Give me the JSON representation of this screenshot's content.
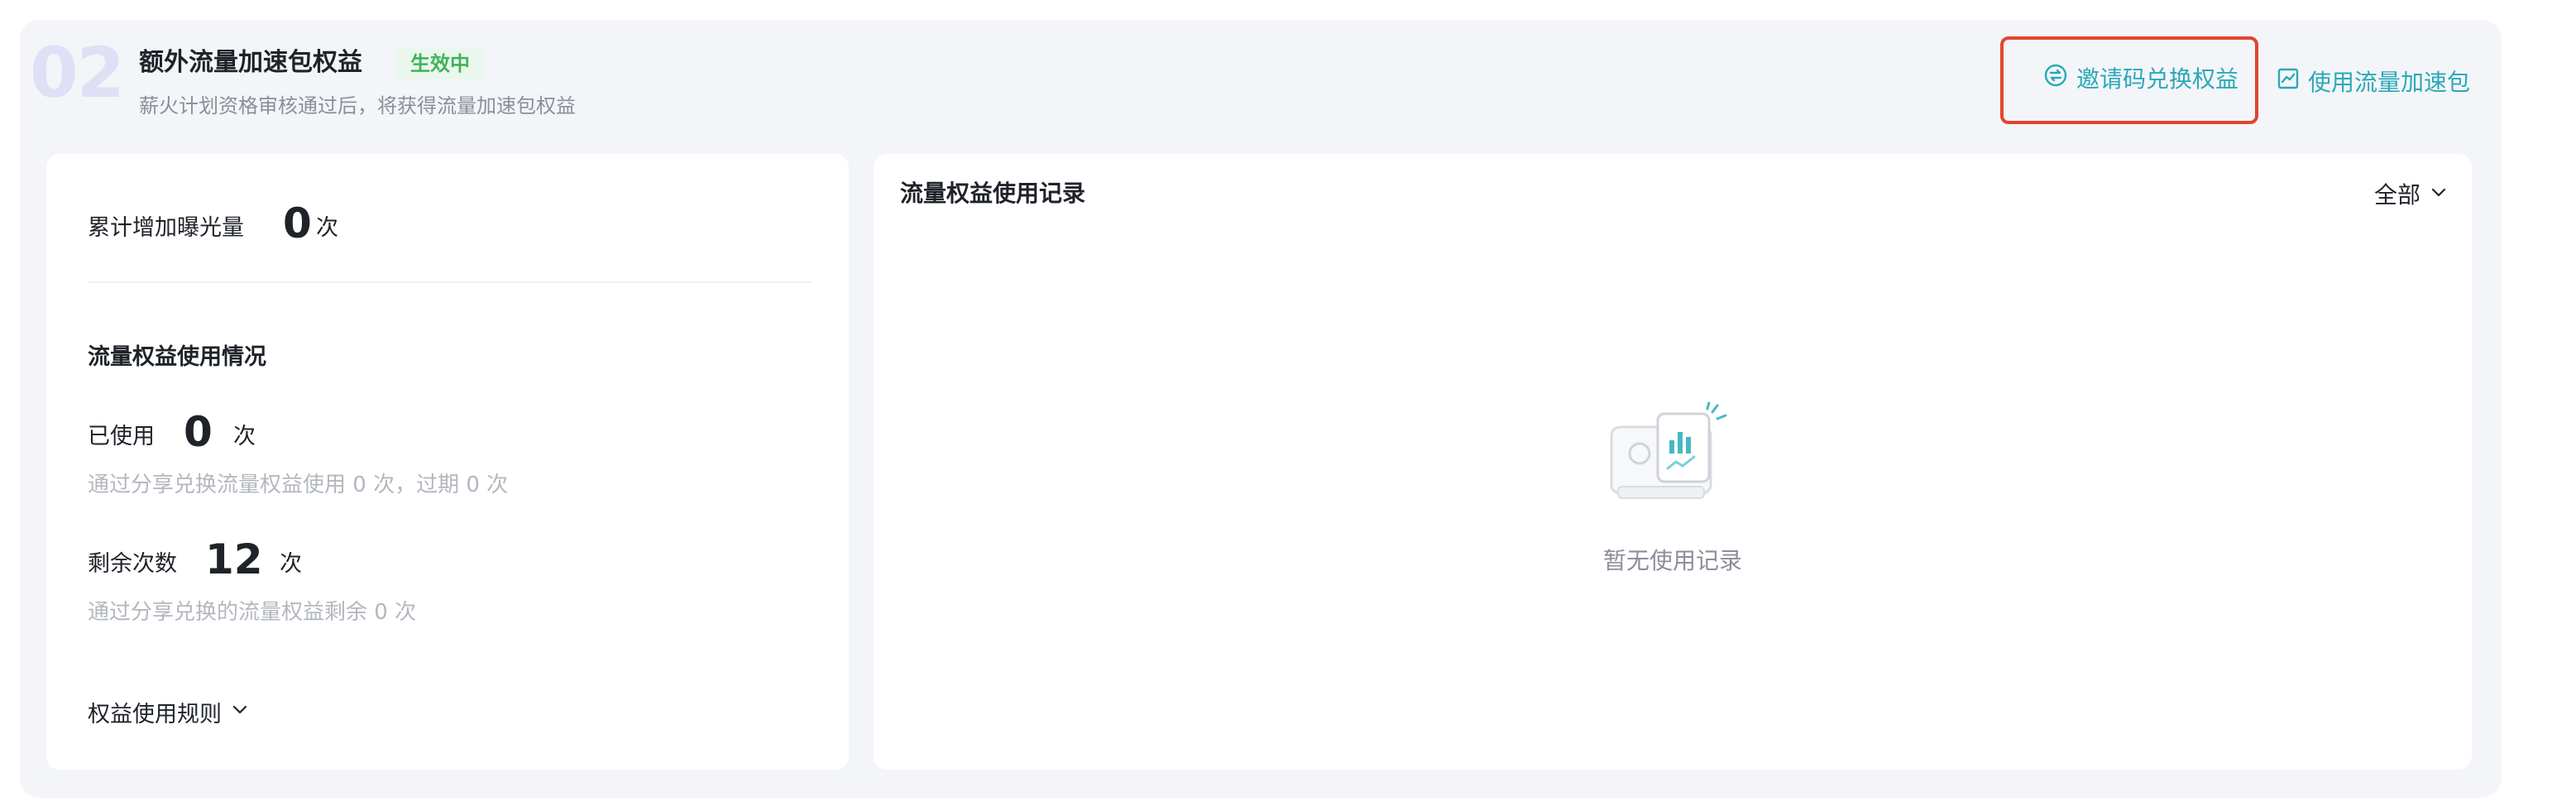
{
  "section": {
    "number": "02",
    "title": "额外流量加速包权益",
    "status": "生效中",
    "subtitle": "薪火计划资格审核通过后，将获得流量加速包权益"
  },
  "actions": {
    "invite_label": "邀请码兑换权益",
    "invite_icon": "exchange-icon",
    "boost_label": "使用流量加速包",
    "boost_icon": "trend-chart-icon",
    "accent_color": "#2aa9b8",
    "highlight_color": "#e2442f"
  },
  "summary": {
    "exposure_label": "累计增加曝光量",
    "exposure_value": "0",
    "exposure_unit": "次",
    "usage_heading": "流量权益使用情况",
    "used_label": "已使用",
    "used_value": "0",
    "used_unit": "次",
    "used_note": "通过分享兑换流量权益使用 0 次，过期 0 次",
    "remaining_label": "剩余次数",
    "remaining_value": "12",
    "remaining_unit": "次",
    "remaining_note": "通过分享兑换的流量权益剩余 0 次",
    "rules_label": "权益使用规则"
  },
  "records": {
    "title": "流量权益使用记录",
    "filter_label": "全部",
    "empty_text": "暂无使用记录"
  }
}
